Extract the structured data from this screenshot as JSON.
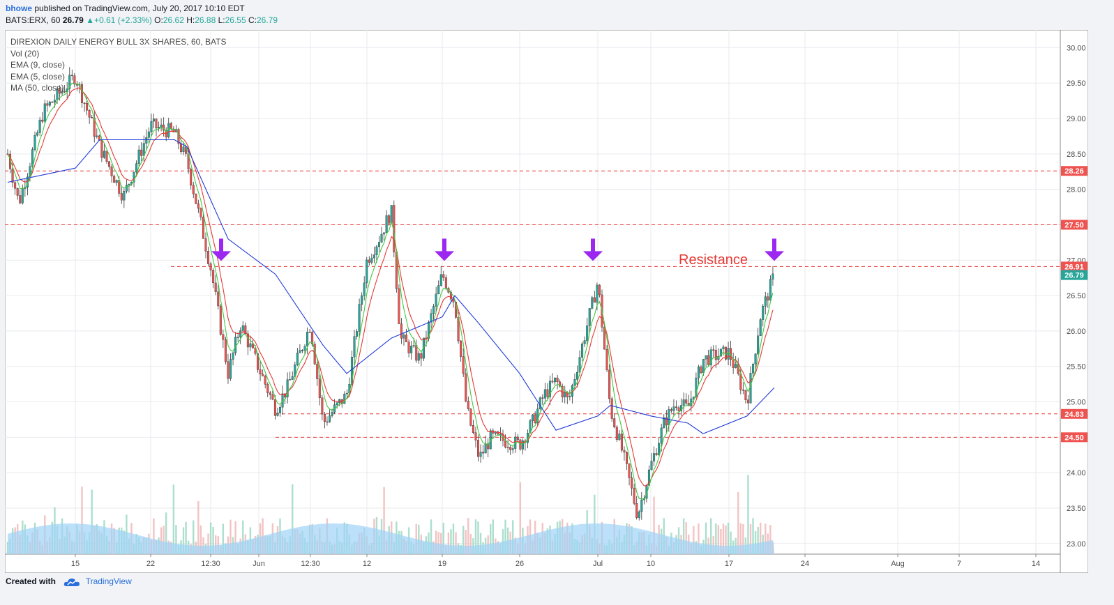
{
  "header": {
    "publisher": "bhowe",
    "published_text": "published on TradingView.com, July 20, 2017 10:10 EDT",
    "symbol_line": "BATS:ERX, 60",
    "last": "26.79",
    "change": "+0.61 (+2.33%)",
    "o_label": "O:",
    "o_value": "26.62",
    "h_label": "H:",
    "h_value": "26.88",
    "l_label": "L:",
    "l_value": "26.55",
    "c_label": "C:",
    "c_value": "26.79"
  },
  "legend": {
    "title": "DIREXION DAILY ENERGY BULL 3X SHARES, 60, BATS",
    "items": [
      "Vol (20)",
      "EMA (9, close)",
      "EMA (5, close)",
      "MA (50, close)"
    ]
  },
  "footer": {
    "created_with": "Created with",
    "brand": "TradingView"
  },
  "colors": {
    "up": "#26a69a",
    "down": "#ef5350",
    "ema9": "#e53935",
    "ema5": "#43c843",
    "ma50": "#1e3ad8",
    "level_line": "#e53935",
    "arrow": "#9c27f0",
    "volume_ma": "#9fd3f7"
  },
  "chart_data": {
    "type": "candlestick",
    "title": "DIREXION DAILY ENERGY BULL 3X SHARES, 60, BATS",
    "x_tick_labels": [
      "15",
      "22",
      "12:30",
      "Jun",
      "12:30",
      "12",
      "19",
      "26",
      "Jul",
      "10",
      "17",
      "24",
      "Aug",
      "7",
      "14"
    ],
    "y_ticks": [
      "30.00",
      "29.50",
      "29.00",
      "28.50",
      "28.00",
      "27.50",
      "27.00",
      "26.50",
      "26.00",
      "25.50",
      "25.00",
      "24.50",
      "24.00",
      "23.50",
      "23.00"
    ],
    "ylim": [
      22.85,
      30.25
    ],
    "price_keypoints": [
      {
        "x": "May 9",
        "y": 28.5
      },
      {
        "x": "May 10",
        "y": 27.8
      },
      {
        "x": "May 12",
        "y": 29.1
      },
      {
        "x": "May 15",
        "y": 29.6
      },
      {
        "x": "May 17",
        "y": 28.6
      },
      {
        "x": "May 19",
        "y": 27.9
      },
      {
        "x": "May 22",
        "y": 28.9
      },
      {
        "x": "May 24",
        "y": 28.8
      },
      {
        "x": "May 25",
        "y": 28.4
      },
      {
        "x": "May 26",
        "y": 26.9
      },
      {
        "x": "May 30",
        "y": 25.4
      },
      {
        "x": "May 31",
        "y": 26.1
      },
      {
        "x": "Jun 2",
        "y": 24.9
      },
      {
        "x": "Jun 5",
        "y": 25.2
      },
      {
        "x": "Jun 6",
        "y": 26.1
      },
      {
        "x": "Jun 7",
        "y": 24.7
      },
      {
        "x": "Jun 9",
        "y": 25.1
      },
      {
        "x": "Jun 12",
        "y": 27.0
      },
      {
        "x": "Jun 13",
        "y": 27.3
      },
      {
        "x": "Jun 14",
        "y": 27.7
      },
      {
        "x": "Jun 15",
        "y": 25.9
      },
      {
        "x": "Jun 16",
        "y": 25.6
      },
      {
        "x": "Jun 19",
        "y": 26.8
      },
      {
        "x": "Jun 20",
        "y": 26.4
      },
      {
        "x": "Jun 21",
        "y": 24.9
      },
      {
        "x": "Jun 22",
        "y": 24.2
      },
      {
        "x": "Jun 23",
        "y": 24.5
      },
      {
        "x": "Jun 26",
        "y": 24.4
      },
      {
        "x": "Jun 27",
        "y": 24.7
      },
      {
        "x": "Jun 28",
        "y": 25.1
      },
      {
        "x": "Jun 29",
        "y": 25.3
      },
      {
        "x": "Jun 30",
        "y": 25.0
      },
      {
        "x": "Jul 3",
        "y": 26.7
      },
      {
        "x": "Jul 5",
        "y": 24.9
      },
      {
        "x": "Jul 6",
        "y": 24.3
      },
      {
        "x": "Jul 7",
        "y": 23.4
      },
      {
        "x": "Jul 10",
        "y": 24.1
      },
      {
        "x": "Jul 11",
        "y": 24.7
      },
      {
        "x": "Jul 12",
        "y": 25.0
      },
      {
        "x": "Jul 13",
        "y": 24.9
      },
      {
        "x": "Jul 14",
        "y": 25.6
      },
      {
        "x": "Jul 17",
        "y": 25.7
      },
      {
        "x": "Jul 18",
        "y": 25.0
      },
      {
        "x": "Jul 19",
        "y": 26.2
      },
      {
        "x": "Jul 20",
        "y": 26.79
      }
    ],
    "ma50_keypoints": [
      {
        "x": "May 9",
        "y": 28.1
      },
      {
        "x": "May 15",
        "y": 28.3
      },
      {
        "x": "May 17",
        "y": 28.7
      },
      {
        "x": "May 24",
        "y": 28.7
      },
      {
        "x": "May 25",
        "y": 28.6
      },
      {
        "x": "May 30",
        "y": 27.3
      },
      {
        "x": "Jun 2",
        "y": 26.8
      },
      {
        "x": "Jun 7",
        "y": 25.8
      },
      {
        "x": "Jun 9",
        "y": 25.4
      },
      {
        "x": "Jun 14",
        "y": 25.9
      },
      {
        "x": "Jun 19",
        "y": 26.2
      },
      {
        "x": "Jun 20",
        "y": 26.5
      },
      {
        "x": "Jun 22",
        "y": 26.1
      },
      {
        "x": "Jun 26",
        "y": 25.4
      },
      {
        "x": "Jun 29",
        "y": 24.6
      },
      {
        "x": "Jul 3",
        "y": 24.8
      },
      {
        "x": "Jul 5",
        "y": 24.95
      },
      {
        "x": "Jul 10",
        "y": 24.8
      },
      {
        "x": "Jul 13",
        "y": 24.7
      },
      {
        "x": "Jul 14",
        "y": 24.55
      },
      {
        "x": "Jul 18",
        "y": 24.8
      },
      {
        "x": "Jul 20",
        "y": 25.2
      }
    ],
    "horizontal_levels": [
      28.26,
      27.5,
      26.91,
      24.83,
      24.5
    ],
    "price_labels": [
      {
        "value": 28.26,
        "label": "28.26",
        "kind": "level"
      },
      {
        "value": 27.5,
        "label": "27.50",
        "kind": "level"
      },
      {
        "value": 26.91,
        "label": "26.91",
        "kind": "level"
      },
      {
        "value": 26.79,
        "label": "26.79",
        "kind": "last"
      },
      {
        "value": 24.83,
        "label": "24.83",
        "kind": "level"
      },
      {
        "value": 24.5,
        "label": "24.50",
        "kind": "level"
      }
    ],
    "annotations": [
      {
        "text": "Resistance",
        "value": 26.91
      }
    ],
    "resistance_touches": [
      "May 26",
      "Jun 19",
      "Jul 3",
      "Jul 20"
    ],
    "volume": "Vol (20)",
    "grid": true
  }
}
